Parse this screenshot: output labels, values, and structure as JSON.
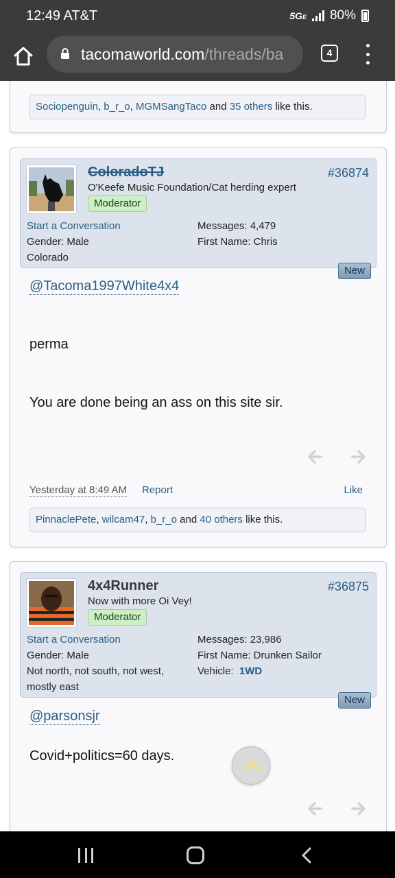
{
  "status_bar": {
    "time": "12:49 AT&T",
    "network": "5G",
    "network_suffix": "E",
    "battery": "80%"
  },
  "browser": {
    "url_domain": "tacomaworld.com",
    "url_path": "/threads/ba",
    "tab_count": "4"
  },
  "posts": [
    {
      "likes": {
        "names": [
          "Sociopenguin",
          "b_r_o",
          "MGMSangTaco"
        ],
        "others": "35 others",
        "suffix": "like this.",
        "conj": "and"
      }
    },
    {
      "username": "ColoradoTJ",
      "user_title": "O'Keefe Music Foundation/Cat herding expert",
      "badge": "Moderator",
      "post_number": "#36874",
      "start_conversation": "Start a Conversation",
      "gender": "Gender:  Male",
      "location": "Colorado",
      "messages": "Messages:  4,479",
      "first_name": "First Name:  Chris",
      "new_tag": "New",
      "mention": "@Tacoma1997White4x4",
      "lines": [
        "perma",
        "You are done being an ass on this site sir."
      ],
      "date": "Yesterday at 8:49 AM",
      "report": "Report",
      "like": "Like",
      "likes": {
        "names": [
          "PinnaclePete",
          "wilcam47",
          "b_r_o"
        ],
        "others": "40 others",
        "suffix": "like this.",
        "conj": "and"
      }
    },
    {
      "username": "4x4Runner",
      "user_title": "Now with more Oi Vey!",
      "badge": "Moderator",
      "post_number": "#36875",
      "start_conversation": "Start a Conversation",
      "gender": "Gender:  Male",
      "location_line1": "Not north, not south, not west,",
      "location_line2": "mostly east",
      "messages": "Messages:  23,986",
      "first_name": "First Name:  Drunken Sailor",
      "vehicle_label": "Vehicle:",
      "vehicle_value": "1WD",
      "new_tag": "New",
      "mention": "@parsonsjr",
      "lines": [
        "Covid+politics=60 days."
      ]
    }
  ],
  "colors": {
    "link": "#2a5d84",
    "moderator_badge": "#ccf0c4",
    "userinfo_bg": "#dde3ed",
    "chrome": "#3b3b3b"
  }
}
